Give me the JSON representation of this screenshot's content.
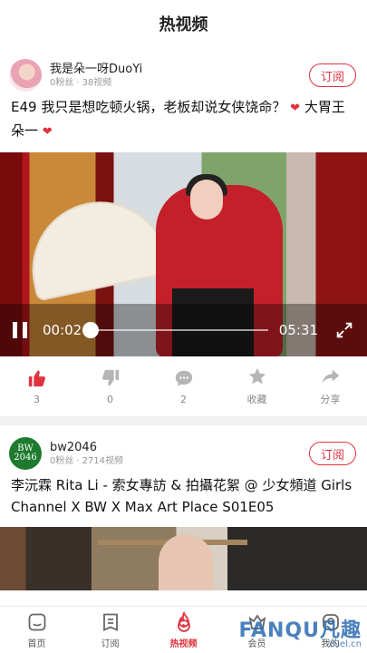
{
  "header": {
    "title": "热视频"
  },
  "feed": [
    {
      "author": {
        "name": "我是朵一呀DuoYi",
        "fans": "0粉丝",
        "videos": "38视频"
      },
      "subscribe_label": "订阅",
      "title": "E49 我只是想吃顿火锅，老板却说女侠饶命？",
      "title_suffix": "大胃王朵一",
      "player": {
        "current_time": "00:02",
        "total_time": "05:31",
        "progress": 0.0
      },
      "actions": {
        "like": "3",
        "dislike": "0",
        "comment": "2",
        "collect": "收藏",
        "share": "分享"
      }
    },
    {
      "author": {
        "name": "bw2046",
        "fans": "0粉丝",
        "videos": "2714视频",
        "avatar_text": "BW 2046"
      },
      "subscribe_label": "订阅",
      "title": "李沅霖 Rita Li - 索女專訪 & 拍攝花絮 @ 少女頻道 Girls Channel X BW X Max Art Place S01E05"
    }
  ],
  "tabbar": [
    {
      "label": "首页",
      "icon": "home-icon",
      "active": false
    },
    {
      "label": "订阅",
      "icon": "subscription-icon",
      "active": false
    },
    {
      "label": "热视频",
      "icon": "hot-video-icon",
      "active": true
    },
    {
      "label": "会员",
      "icon": "member-icon",
      "active": false
    },
    {
      "label": "我的",
      "icon": "profile-icon",
      "active": false
    }
  ],
  "watermark": {
    "main": "FANQU凡趣",
    "sub": "cuel.cn"
  },
  "colors": {
    "accent": "#e0323f",
    "muted": "#999999"
  }
}
